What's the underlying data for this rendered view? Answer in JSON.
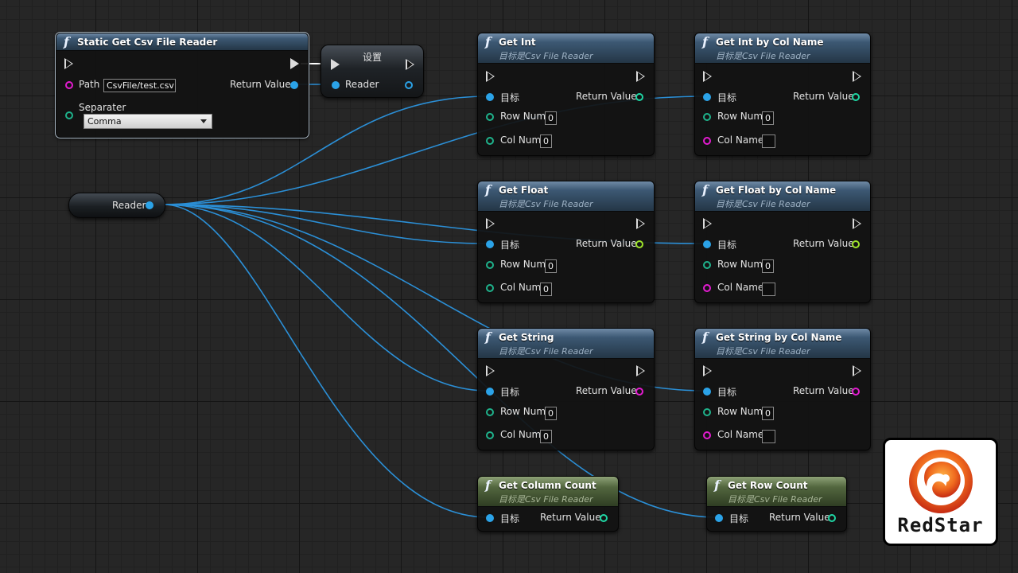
{
  "colors": {
    "object_pin": "#2ba3e8",
    "int_pin": "#1fd6a4",
    "string_pin": "#e31bd0",
    "float_pin": "#9ee32a",
    "function_header": "#3c5873",
    "pure_header": "#53673f",
    "wire": "#2b8fd6",
    "logo_accent": "#e8401c"
  },
  "static_node": {
    "title": "Static Get Csv File Reader",
    "icon": "function-icon",
    "path_label": "Path",
    "path_value": "CsvFile/test.csv",
    "separater_label": "Separater",
    "separater_value": "Comma",
    "return_label": "Return Value"
  },
  "set_node": {
    "title": "设置",
    "reader_label": "Reader"
  },
  "reader_variable": {
    "label": "Reader"
  },
  "common": {
    "subtitle": "目标是Csv File Reader",
    "target_label": "目标",
    "return_label": "Return Value",
    "row_num_label": "Row Num",
    "col_num_label": "Col Num",
    "col_name_label": "Col Name",
    "zero": "0"
  },
  "nodes": {
    "get_int": {
      "title": "Get Int"
    },
    "get_int_by_col": {
      "title": "Get Int by Col Name"
    },
    "get_float": {
      "title": "Get Float"
    },
    "get_float_by_col": {
      "title": "Get Float by Col Name"
    },
    "get_string": {
      "title": "Get String"
    },
    "get_string_by_col": {
      "title": "Get String by Col Name"
    },
    "get_column_count": {
      "title": "Get Column Count"
    },
    "get_row_count": {
      "title": "Get Row Count"
    }
  },
  "logo": {
    "text": "RedStar"
  }
}
